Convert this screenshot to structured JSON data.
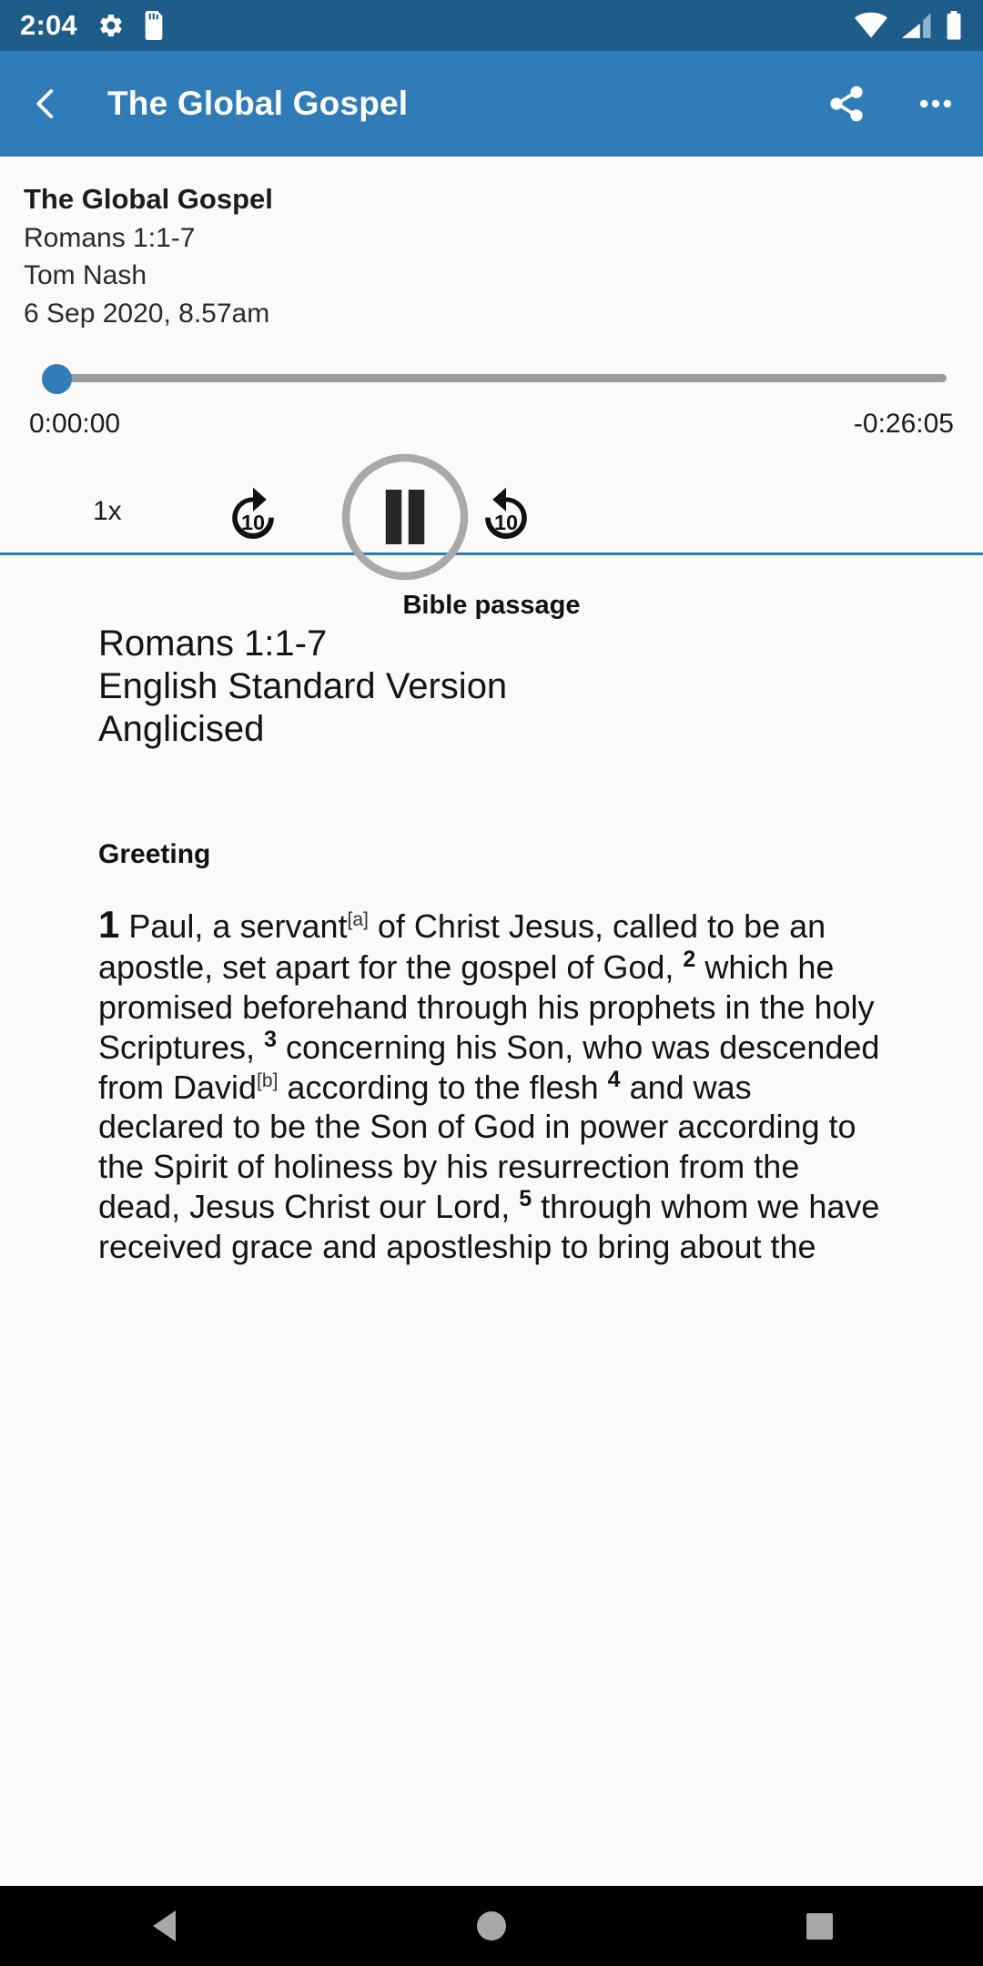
{
  "status_bar": {
    "time": "2:04",
    "icons": [
      "gear-icon",
      "sd-card-icon",
      "wifi-icon",
      "cellular-signal-icon",
      "battery-icon"
    ],
    "background": "#1e5c8a"
  },
  "app_bar": {
    "title": "The Global Gospel",
    "back_icon": "chevron-left-icon",
    "share_icon": "share-icon",
    "overflow_icon": "more-options-icon",
    "background": "#2f7cb8"
  },
  "player": {
    "episode_title": "The Global Gospel",
    "reference": "Romans 1:1-7",
    "speaker": "Tom Nash",
    "date": "6 Sep 2020, 8.57am",
    "elapsed": "0:00:00",
    "remaining": "-0:26:05",
    "progress_percent": 0,
    "speed": "1x",
    "skip_back_label": "10",
    "skip_forward_label": "10",
    "playback_state": "playing",
    "accent_color": "#2f7cb8",
    "tab_label": "Bible passage"
  },
  "passage": {
    "reference": "Romans 1:1-7",
    "version_line1": "English Standard Version",
    "version_line2": "Anglicised",
    "section_heading": "Greeting",
    "verses": [
      {
        "number": "1",
        "footnote": "a",
        "text_before_footnote": "Paul, a servant",
        "text_after_footnote": " of Christ Jesus, called to be an apostle, set apart for the gospel of God,"
      },
      {
        "number": "2",
        "text": "which he promised beforehand through his prophets in the holy Scriptures,"
      },
      {
        "number": "3",
        "footnote": "b",
        "text_before_footnote": "concerning his Son, who was descended from David",
        "text_after_footnote": " according to the flesh"
      },
      {
        "number": "4",
        "text": "and was declared to be the Son of God in power according to the Spirit of holiness by his resurrection from the dead, Jesus Christ our Lord,"
      },
      {
        "number": "5",
        "text": "through whom we have received grace and apostleship to bring about the"
      }
    ]
  },
  "nav_bar": {
    "back": "back-button",
    "home": "home-button",
    "recents": "recents-button"
  }
}
